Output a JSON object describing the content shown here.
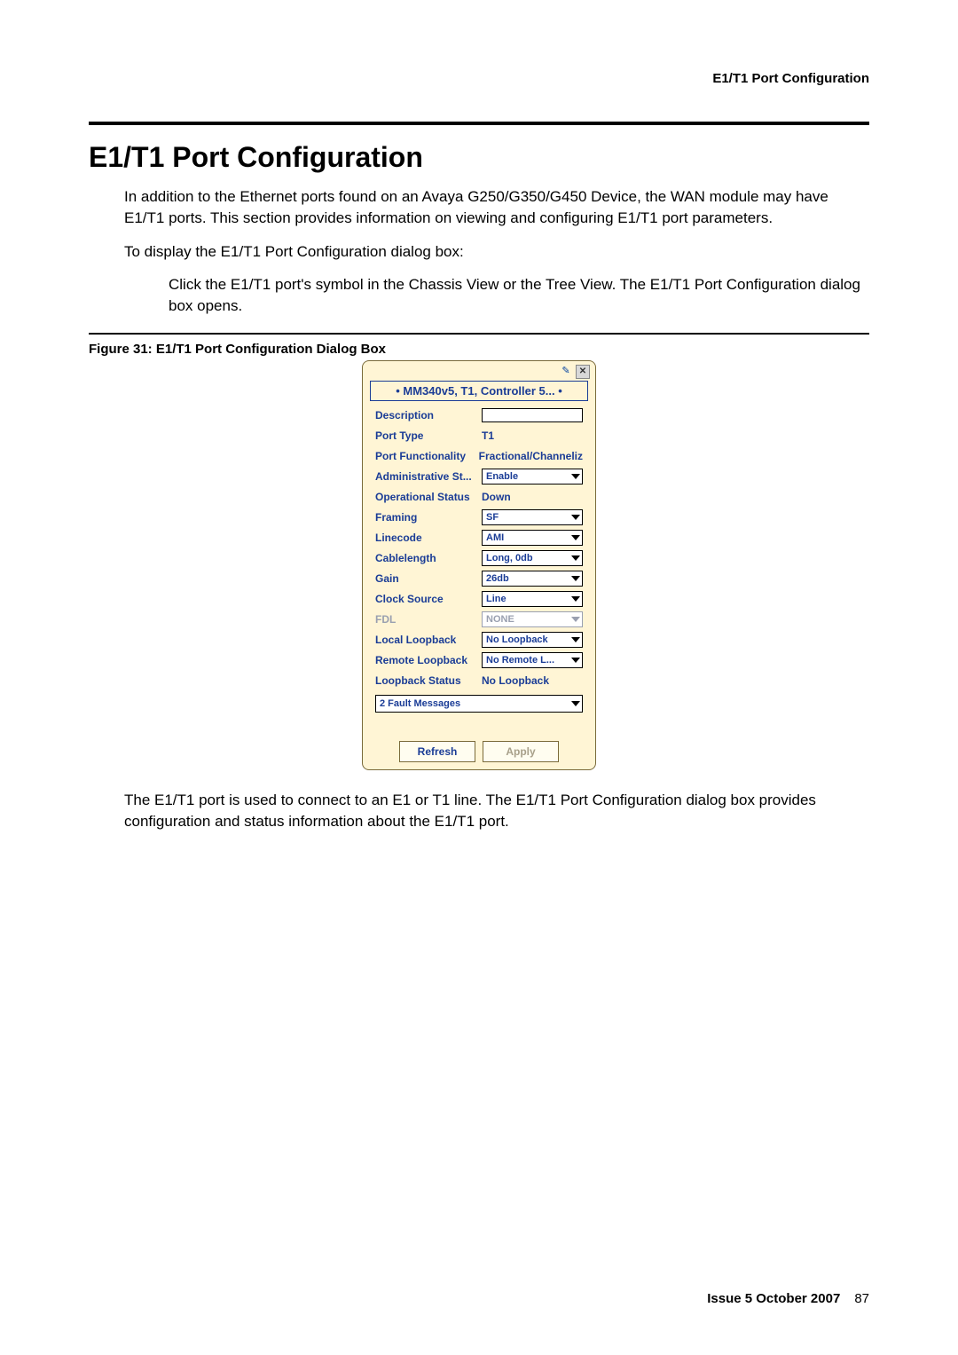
{
  "header": {
    "running_title": "E1/T1 Port Configuration"
  },
  "heading": "E1/T1 Port Configuration",
  "para1": "In addition to the Ethernet ports found on an Avaya G250/G350/G450 Device, the WAN module may have E1/T1 ports. This section provides information on viewing and configuring E1/T1 port parameters.",
  "para2": "To display the E1/T1 Port Configuration dialog box:",
  "para3": "Click the E1/T1 port's symbol in the Chassis View or the Tree View. The E1/T1 Port Configuration dialog box opens.",
  "figure_caption": "Figure 31: E1/T1 Port Configuration Dialog Box",
  "dialog": {
    "tab_title": "MM340v5, T1, Controller 5...",
    "rows": {
      "description": {
        "label": "Description",
        "value": ""
      },
      "port_type": {
        "label": "Port Type",
        "value": "T1"
      },
      "port_functionality": {
        "label": "Port Functionality",
        "value": "Fractional/Channeliz"
      },
      "admin_status": {
        "label": "Administrative St...",
        "value": "Enable"
      },
      "operational_status": {
        "label": "Operational Status",
        "value": "Down"
      },
      "framing": {
        "label": "Framing",
        "value": "SF"
      },
      "linecode": {
        "label": "Linecode",
        "value": "AMI"
      },
      "cablelength": {
        "label": "Cablelength",
        "value": "Long, 0db"
      },
      "gain": {
        "label": "Gain",
        "value": "26db"
      },
      "clock_source": {
        "label": "Clock Source",
        "value": "Line"
      },
      "fdl": {
        "label": "FDL",
        "value": "NONE"
      },
      "local_loopback": {
        "label": "Local Loopback",
        "value": "No Loopback"
      },
      "remote_loopback": {
        "label": "Remote Loopback",
        "value": "No Remote L..."
      },
      "loopback_status": {
        "label": "Loopback Status",
        "value": "No Loopback"
      }
    },
    "fault_messages": "2 Fault Messages",
    "buttons": {
      "refresh": "Refresh",
      "apply": "Apply"
    }
  },
  "para4": "The E1/T1 port is used to connect to an E1 or T1 line. The E1/T1 Port Configuration dialog box provides configuration and status information about the E1/T1 port.",
  "footer": {
    "issue": "Issue 5   October 2007",
    "page": "87"
  }
}
